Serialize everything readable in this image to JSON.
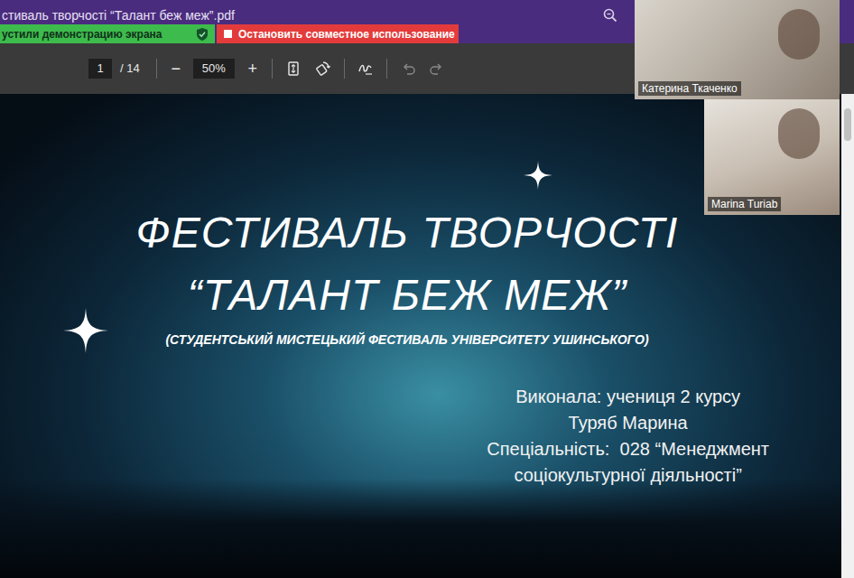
{
  "window": {
    "title": "стиваль творчості “Талант беж меж”.pdf"
  },
  "share_bar": {
    "status": "устили демонстрацию экрана",
    "stop_button": "Остановить совместное использование"
  },
  "toolbar": {
    "page": "1",
    "page_total": "/ 14",
    "zoom_out": "−",
    "zoom": "50%",
    "zoom_in": "+"
  },
  "slide": {
    "title_lines": [
      "ФЕСТИВАЛЬ ТВОРЧОСТІ",
      "“ТАЛАНТ БЕЖ МЕЖ”"
    ],
    "subtitle": "(СТУДЕНТСЬКИЙ МИСТЕЦЬКИЙ ФЕСТИВАЛЬ УНІВЕРСИТЕТУ УШИНСЬКОГО)",
    "author_lines": [
      "Виконала: учениця 2 курсу",
      "Туряб Марина",
      "Спеціальність:  028 “Менеджмент",
      "соціокультурної діяльності”"
    ]
  },
  "participants": [
    {
      "name": "Катерина Ткаченко"
    },
    {
      "name": "Marina Turiab"
    }
  ]
}
